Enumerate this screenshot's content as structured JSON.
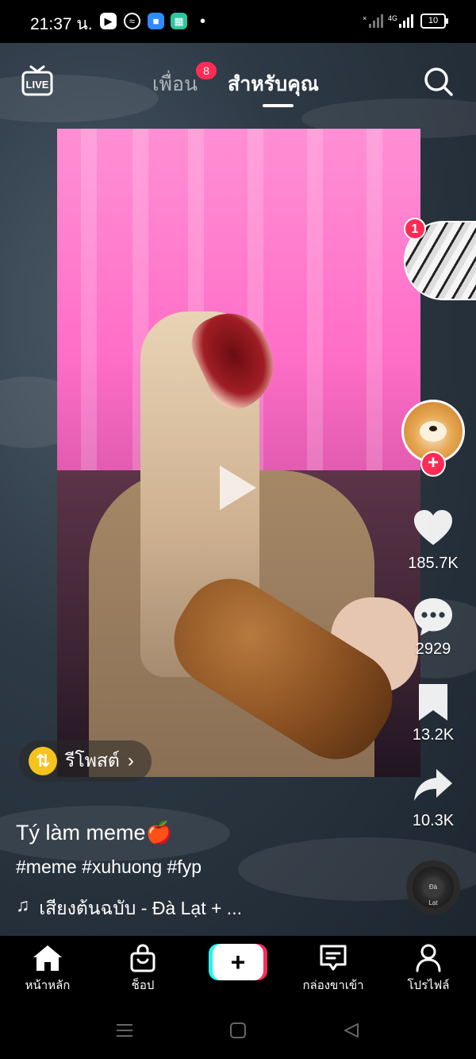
{
  "status_bar": {
    "time": "21:37 น.",
    "network_label": "4G",
    "battery_level": "10"
  },
  "top_nav": {
    "live_label": "LIVE",
    "tab_friends": "เพื่อน",
    "friends_badge": "8",
    "tab_for_you": "สำหรับคุณ"
  },
  "right_rail": {
    "story_badge": "1",
    "follow_symbol": "+",
    "likes": "185.7K",
    "comments": "2929",
    "saves": "13.2K",
    "shares": "10.3K",
    "disc_label": "Đà Lạt"
  },
  "repost": {
    "label": "รีโพสต์"
  },
  "caption": {
    "username": "Tý làm meme🍎",
    "hashtags": "#meme #xuhuong #fyp",
    "music": "เสียงต้นฉบับ - Đà Lạt + ..."
  },
  "bottom_nav": {
    "home": "หน้าหลัก",
    "shop": "ช็อป",
    "create_symbol": "+",
    "inbox": "กล่องขาเข้า",
    "profile": "โปรไฟล์"
  },
  "colors": {
    "accent_red": "#fe2c55",
    "accent_cyan": "#25f4ee",
    "repost_yellow": "#f6c21c"
  },
  "icons": [
    "live-icon",
    "search-icon",
    "play-icon",
    "heart-icon",
    "comment-icon",
    "bookmark-icon",
    "share-icon",
    "repost-icon",
    "music-note-icon",
    "home-icon",
    "shop-icon",
    "inbox-icon",
    "profile-icon"
  ]
}
